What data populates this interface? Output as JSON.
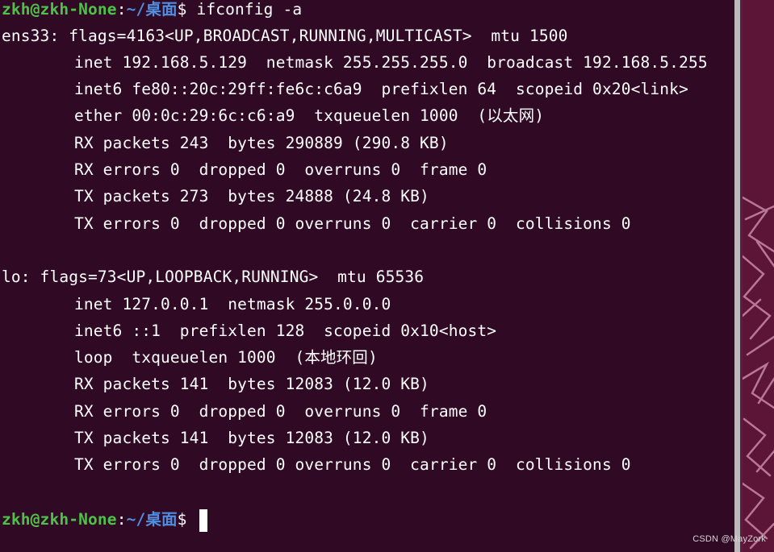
{
  "terminal": {
    "prompt_user_host": "zkh@zkh-None",
    "prompt_sep": ":",
    "prompt_path": "~/桌面",
    "prompt_dollar": "$ ",
    "command": "ifconfig -a",
    "ens33": {
      "header": "ens33: flags=4163<UP,BROADCAST,RUNNING,MULTICAST>  mtu 1500",
      "lines": [
        "inet 192.168.5.129  netmask 255.255.255.0  broadcast 192.168.5.255",
        "inet6 fe80::20c:29ff:fe6c:c6a9  prefixlen 64  scopeid 0x20<link>",
        "ether 00:0c:29:6c:c6:a9  txqueuelen 1000  (以太网)",
        "RX packets 243  bytes 290889 (290.8 KB)",
        "RX errors 0  dropped 0  overruns 0  frame 0",
        "TX packets 273  bytes 24888 (24.8 KB)",
        "TX errors 0  dropped 0 overruns 0  carrier 0  collisions 0"
      ]
    },
    "lo": {
      "header": "lo: flags=73<UP,LOOPBACK,RUNNING>  mtu 65536",
      "lines": [
        "inet 127.0.0.1  netmask 255.0.0.0",
        "inet6 ::1  prefixlen 128  scopeid 0x10<host>",
        "loop  txqueuelen 1000  (本地环回)",
        "RX packets 141  bytes 12083 (12.0 KB)",
        "RX errors 0  dropped 0  overruns 0  frame 0",
        "TX packets 141  bytes 12083 (12.0 KB)",
        "TX errors 0  dropped 0 overruns 0  carrier 0  collisions 0"
      ]
    }
  },
  "watermark": "CSDN @MayZork",
  "colors": {
    "background": "#300a24",
    "prompt_user": "#4ec248",
    "prompt_path": "#4f8ee0",
    "text": "#ffffff",
    "wallpaper": "#5c1537"
  }
}
